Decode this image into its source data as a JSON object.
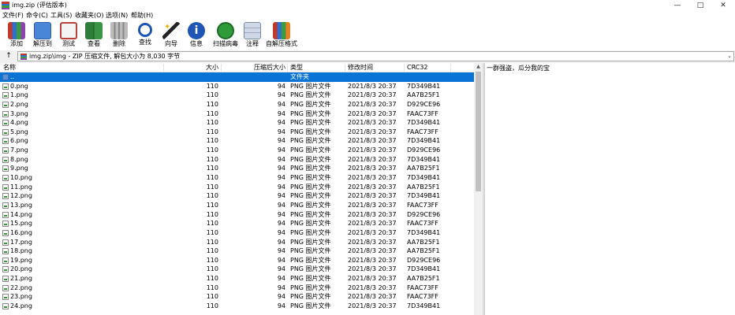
{
  "window": {
    "title": "img.zip (评估版本)",
    "minimize_glyph": "—",
    "maximize_glyph": "□",
    "close_glyph": "✕"
  },
  "menu": [
    {
      "label": "文件(F)"
    },
    {
      "label": "命令(C)"
    },
    {
      "label": "工具(S)"
    },
    {
      "label": "收藏夹(O)"
    },
    {
      "label": "选项(N)"
    },
    {
      "label": "帮助(H)"
    }
  ],
  "toolbar": [
    {
      "label": "添加",
      "icon": "add-books-icon"
    },
    {
      "label": "解压到",
      "icon": "extract-folder-icon"
    },
    {
      "label": "测试",
      "icon": "test-clipboard-icon"
    },
    {
      "label": "查看",
      "icon": "view-book-icon"
    },
    {
      "label": "删除",
      "icon": "trash-icon"
    },
    {
      "label": "查找",
      "icon": "magnifier-icon"
    },
    {
      "label": "向导",
      "icon": "wizard-wand-icon"
    },
    {
      "label": "信息",
      "icon": "info-icon"
    },
    {
      "label": "扫描病毒",
      "icon": "virus-scan-icon"
    },
    {
      "label": "注释",
      "icon": "comment-icon"
    },
    {
      "label": "自解压格式",
      "icon": "sfx-box-icon"
    }
  ],
  "address": {
    "up_glyph": "↑",
    "path": "img.zip\\img - ZIP 压缩文件, 解包大小为 8,030 字节",
    "dropdown_glyph": "⌄"
  },
  "columns": {
    "name": "名称",
    "size": "大小",
    "packed": "压缩后大小",
    "type": "类型",
    "modified": "修改时间",
    "crc": "CRC32"
  },
  "parent_row": {
    "name": "..",
    "type": "文件夹"
  },
  "files": [
    {
      "name": "0.png",
      "size": "110",
      "packed": "94",
      "type": "PNG 图片文件",
      "modified": "2021/8/3 20:37",
      "crc": "7D349B41"
    },
    {
      "name": "1.png",
      "size": "110",
      "packed": "94",
      "type": "PNG 图片文件",
      "modified": "2021/8/3 20:37",
      "crc": "AA7B25F1"
    },
    {
      "name": "2.png",
      "size": "110",
      "packed": "94",
      "type": "PNG 图片文件",
      "modified": "2021/8/3 20:37",
      "crc": "D929CE96"
    },
    {
      "name": "3.png",
      "size": "110",
      "packed": "94",
      "type": "PNG 图片文件",
      "modified": "2021/8/3 20:37",
      "crc": "FAAC73FF"
    },
    {
      "name": "4.png",
      "size": "110",
      "packed": "94",
      "type": "PNG 图片文件",
      "modified": "2021/8/3 20:37",
      "crc": "7D349B41"
    },
    {
      "name": "5.png",
      "size": "110",
      "packed": "94",
      "type": "PNG 图片文件",
      "modified": "2021/8/3 20:37",
      "crc": "FAAC73FF"
    },
    {
      "name": "6.png",
      "size": "110",
      "packed": "94",
      "type": "PNG 图片文件",
      "modified": "2021/8/3 20:37",
      "crc": "7D349B41"
    },
    {
      "name": "7.png",
      "size": "110",
      "packed": "94",
      "type": "PNG 图片文件",
      "modified": "2021/8/3 20:37",
      "crc": "D929CE96"
    },
    {
      "name": "8.png",
      "size": "110",
      "packed": "94",
      "type": "PNG 图片文件",
      "modified": "2021/8/3 20:37",
      "crc": "7D349B41"
    },
    {
      "name": "9.png",
      "size": "110",
      "packed": "94",
      "type": "PNG 图片文件",
      "modified": "2021/8/3 20:37",
      "crc": "AA7B25F1"
    },
    {
      "name": "10.png",
      "size": "110",
      "packed": "94",
      "type": "PNG 图片文件",
      "modified": "2021/8/3 20:37",
      "crc": "7D349B41"
    },
    {
      "name": "11.png",
      "size": "110",
      "packed": "94",
      "type": "PNG 图片文件",
      "modified": "2021/8/3 20:37",
      "crc": "AA7B25F1"
    },
    {
      "name": "12.png",
      "size": "110",
      "packed": "94",
      "type": "PNG 图片文件",
      "modified": "2021/8/3 20:37",
      "crc": "7D349B41"
    },
    {
      "name": "13.png",
      "size": "110",
      "packed": "94",
      "type": "PNG 图片文件",
      "modified": "2021/8/3 20:37",
      "crc": "FAAC73FF"
    },
    {
      "name": "14.png",
      "size": "110",
      "packed": "94",
      "type": "PNG 图片文件",
      "modified": "2021/8/3 20:37",
      "crc": "D929CE96"
    },
    {
      "name": "15.png",
      "size": "110",
      "packed": "94",
      "type": "PNG 图片文件",
      "modified": "2021/8/3 20:37",
      "crc": "FAAC73FF"
    },
    {
      "name": "16.png",
      "size": "110",
      "packed": "94",
      "type": "PNG 图片文件",
      "modified": "2021/8/3 20:37",
      "crc": "7D349B41"
    },
    {
      "name": "17.png",
      "size": "110",
      "packed": "94",
      "type": "PNG 图片文件",
      "modified": "2021/8/3 20:37",
      "crc": "AA7B25F1"
    },
    {
      "name": "18.png",
      "size": "110",
      "packed": "94",
      "type": "PNG 图片文件",
      "modified": "2021/8/3 20:37",
      "crc": "AA7B25F1"
    },
    {
      "name": "19.png",
      "size": "110",
      "packed": "94",
      "type": "PNG 图片文件",
      "modified": "2021/8/3 20:37",
      "crc": "D929CE96"
    },
    {
      "name": "20.png",
      "size": "110",
      "packed": "94",
      "type": "PNG 图片文件",
      "modified": "2021/8/3 20:37",
      "crc": "7D349B41"
    },
    {
      "name": "21.png",
      "size": "110",
      "packed": "94",
      "type": "PNG 图片文件",
      "modified": "2021/8/3 20:37",
      "crc": "AA7B25F1"
    },
    {
      "name": "22.png",
      "size": "110",
      "packed": "94",
      "type": "PNG 图片文件",
      "modified": "2021/8/3 20:37",
      "crc": "FAAC73FF"
    },
    {
      "name": "23.png",
      "size": "110",
      "packed": "94",
      "type": "PNG 图片文件",
      "modified": "2021/8/3 20:37",
      "crc": "FAAC73FF"
    },
    {
      "name": "24.png",
      "size": "110",
      "packed": "94",
      "type": "PNG 图片文件",
      "modified": "2021/8/3 20:37",
      "crc": "7D349B41"
    }
  ],
  "comment": "一群强盗，瓜分我的宝",
  "colors": {
    "selection": "#0a74d6",
    "window_bg": "#f0f0f0",
    "pane_bg": "#ffffff"
  }
}
